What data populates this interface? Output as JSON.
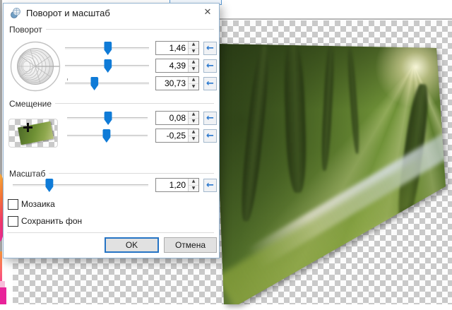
{
  "dialog": {
    "title": "Поворот и масштаб",
    "groups": {
      "rotation": {
        "label": "Поворот"
      },
      "offset": {
        "label": "Смещение"
      },
      "scale": {
        "label": "Масштаб"
      }
    },
    "sliders": {
      "rotation": [
        {
          "value": "1,46",
          "pct": 51
        },
        {
          "value": "4,39",
          "pct": 51
        },
        {
          "value": "30,73",
          "pct": 35
        }
      ],
      "offset": [
        {
          "value": "0,08",
          "pct": 51
        },
        {
          "value": "-0,25",
          "pct": 49
        }
      ],
      "scale": [
        {
          "value": "1,20",
          "pct": 27
        }
      ]
    },
    "checkboxes": [
      {
        "label": "Мозаика",
        "checked": false
      },
      {
        "label": "Сохранить фон",
        "checked": false
      }
    ],
    "buttons": {
      "ok": "OK",
      "cancel": "Отмена"
    }
  },
  "icons": {
    "close": "✕",
    "reset": "←",
    "spin_up": "▲",
    "spin_down": "▼"
  },
  "colors": {
    "accent_blue": "#0f7bd7",
    "checker_gray": "#c9c9c9",
    "magenta_swatch": "#e8239a",
    "dialog_border": "#93b3d0"
  }
}
